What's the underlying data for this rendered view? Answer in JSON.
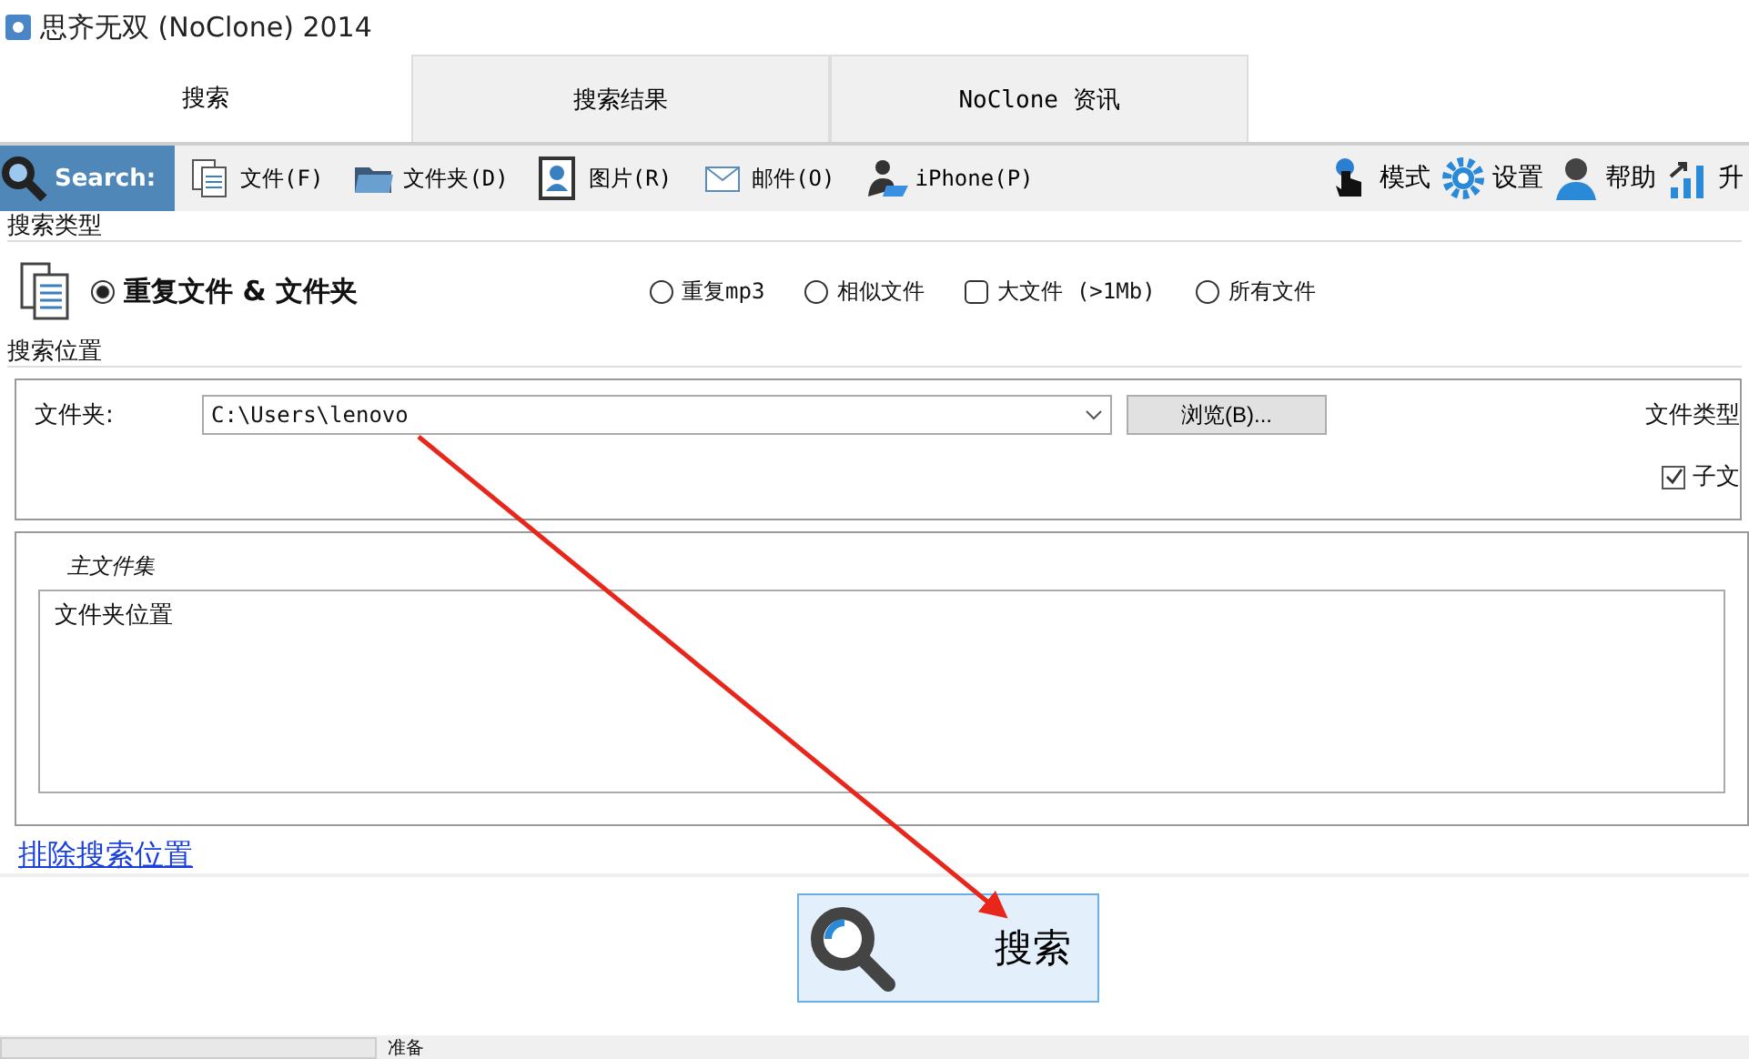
{
  "window": {
    "title": "思齐无双 (NoClone) 2014"
  },
  "tabs": [
    {
      "label": "搜索",
      "selected": true
    },
    {
      "label": "搜索结果",
      "selected": false
    },
    {
      "label": "NoClone 资讯",
      "selected": false
    }
  ],
  "toolbar": {
    "search_label": "Search:",
    "items": [
      {
        "kind": "files",
        "label": "文件(F)"
      },
      {
        "kind": "folder",
        "label": "文件夹(D)"
      },
      {
        "kind": "picture",
        "label": "图片(R)"
      },
      {
        "kind": "mail",
        "label": "邮件(O)"
      },
      {
        "kind": "phone",
        "label": "iPhone(P)"
      }
    ],
    "right_items": [
      {
        "kind": "mode",
        "label": "模式"
      },
      {
        "kind": "settings",
        "label": "设置"
      },
      {
        "kind": "help",
        "label": "帮助"
      },
      {
        "kind": "upgrade",
        "label": "升"
      }
    ]
  },
  "search_type": {
    "heading": "搜索类型",
    "options": [
      {
        "label": "重复文件 & 文件夹",
        "selected": true,
        "kind": "radio"
      },
      {
        "label": "重复mp3",
        "selected": false,
        "kind": "radio"
      },
      {
        "label": "相似文件",
        "selected": false,
        "kind": "radio"
      },
      {
        "label": "大文件 (>1Mb)",
        "selected": false,
        "kind": "box"
      },
      {
        "label": "所有文件",
        "selected": false,
        "kind": "radio"
      }
    ]
  },
  "search_location": {
    "heading": "搜索位置",
    "folder_label": "文件夹:",
    "folder_value": "C:\\Users\\lenovo",
    "browse_button": "浏览(B)...",
    "file_type_label": "文件类型",
    "subfolder": {
      "label": "子文",
      "checked": true
    }
  },
  "main_set": {
    "heading": "主文件集",
    "column": "文件夹位置"
  },
  "exclude_link": "排除搜索位置",
  "search_button": "搜索",
  "status_bar": {
    "text": "准备"
  }
}
